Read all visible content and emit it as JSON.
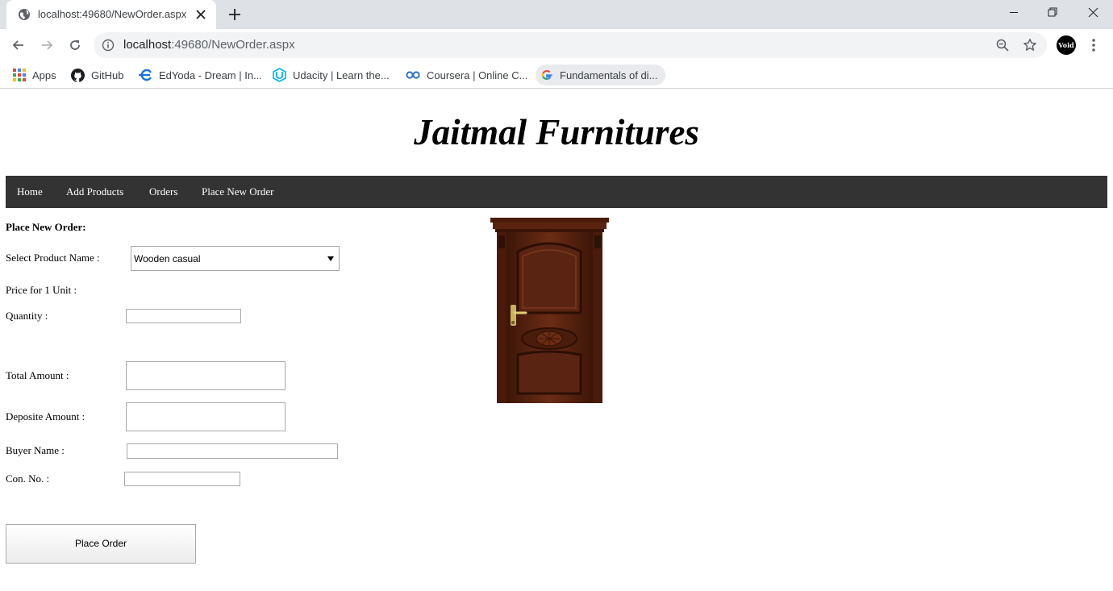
{
  "browser": {
    "tab_title": "localhost:49680/NewOrder.aspx",
    "url_host": "localhost",
    "url_rest": ":49680/NewOrder.aspx",
    "bookmarks": [
      {
        "label": "Apps",
        "icon": "apps-grid-icon"
      },
      {
        "label": "GitHub",
        "icon": "github-icon"
      },
      {
        "label": "EdYoda - Dream | In...",
        "icon": "edyoda-icon"
      },
      {
        "label": "Udacity | Learn the...",
        "icon": "udacity-icon"
      },
      {
        "label": "Coursera | Online C...",
        "icon": "coursera-icon"
      },
      {
        "label": "Fundamentals of di...",
        "icon": "google-icon"
      }
    ],
    "profile_label": "Void"
  },
  "site": {
    "title": "Jaitmal Furnitures",
    "nav": [
      "Home",
      "Add Products",
      "Orders",
      "Place New Order"
    ]
  },
  "form": {
    "heading": "Place New Order:",
    "product_label": "Select Product Name :",
    "product_selected": "Wooden casual",
    "price_label": "Price for 1 Unit :",
    "quantity_label": "Quantity :",
    "total_label": "Total Amount :",
    "deposit_label": "Deposite Amount :",
    "buyer_label": "Buyer Name :",
    "contact_label": "Con. No. :",
    "submit_label": "Place Order"
  },
  "product_image": {
    "icon": "wooden-door-image",
    "color": "#5a2412"
  },
  "colors": {
    "navbar": "#333333",
    "tabstrip": "#dee1e6",
    "omnibox": "#f1f3f4"
  }
}
